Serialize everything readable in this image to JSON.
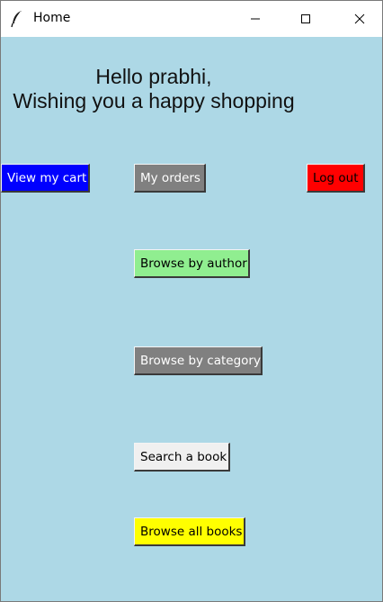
{
  "window": {
    "title": "Home",
    "icon": "feather-icon",
    "controls": [
      "minimize-icon",
      "maximize-icon",
      "close-icon"
    ]
  },
  "greeting": {
    "line1": "Hello prabhi,",
    "line2": "Wishing you a happy shopping"
  },
  "buttons": {
    "view_cart": "View my cart",
    "my_orders": "My orders",
    "log_out": "Log out",
    "browse_author": "Browse by author",
    "browse_category": "Browse by category",
    "search_book": "Search a book",
    "browse_all": "Browse all books"
  },
  "colors": {
    "background": "#add8e6",
    "view_cart": "#0000ff",
    "my_orders": "#808080",
    "log_out": "#ff0000",
    "browse_author": "#90ee90",
    "browse_category": "#808080",
    "search_book": "#f0f0f0",
    "browse_all": "#ffff00"
  }
}
